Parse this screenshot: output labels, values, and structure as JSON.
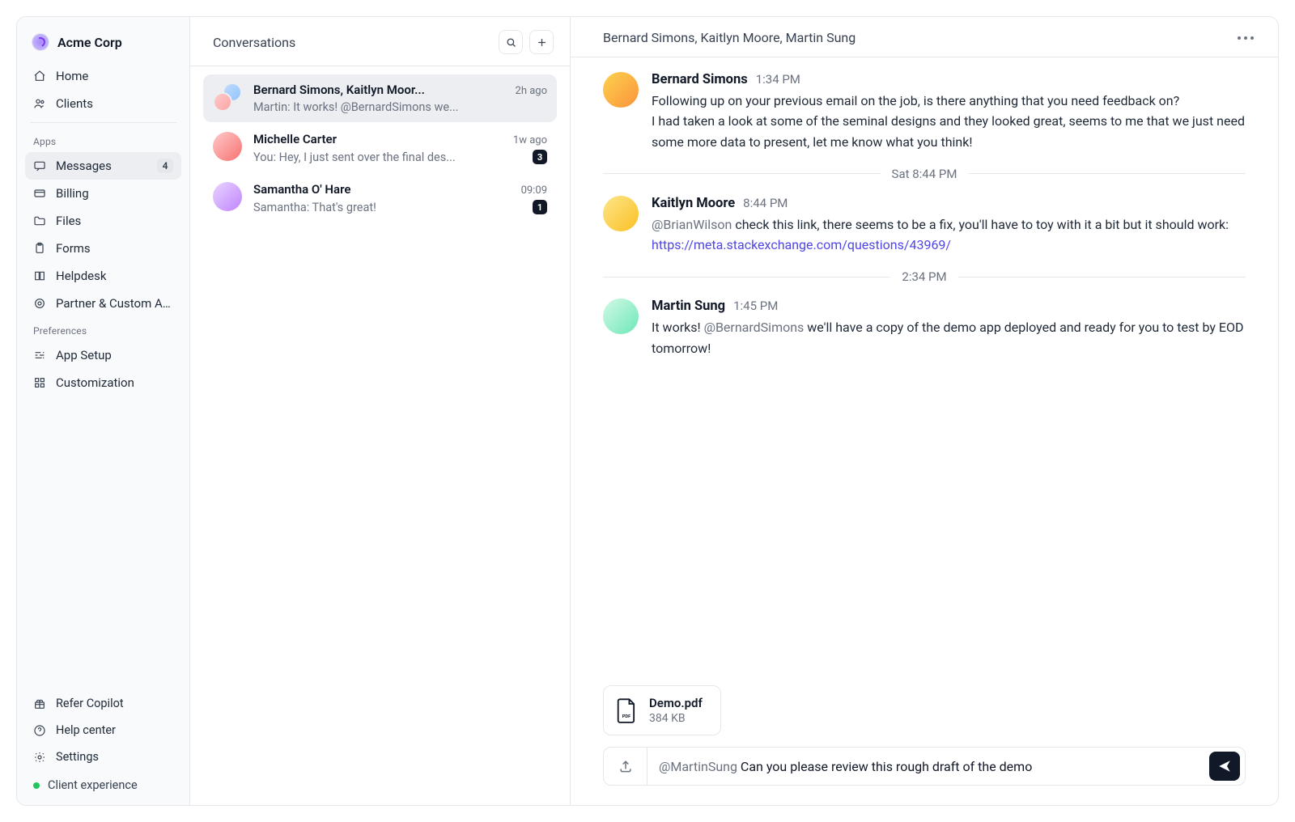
{
  "org": {
    "name": "Acme Corp"
  },
  "nav": {
    "main": [
      {
        "label": "Home"
      },
      {
        "label": "Clients"
      }
    ],
    "apps_label": "Apps",
    "apps": [
      {
        "label": "Messages",
        "badge": "4",
        "selected": true
      },
      {
        "label": "Billing"
      },
      {
        "label": "Files"
      },
      {
        "label": "Forms"
      },
      {
        "label": "Helpdesk"
      },
      {
        "label": "Partner & Custom Apps"
      }
    ],
    "prefs_label": "Preferences",
    "prefs": [
      {
        "label": "App Setup"
      },
      {
        "label": "Customization"
      }
    ],
    "footer": [
      {
        "label": "Refer Copilot"
      },
      {
        "label": "Help center"
      },
      {
        "label": "Settings"
      }
    ],
    "client_experience": "Client experience"
  },
  "conversations": {
    "title": "Conversations",
    "items": [
      {
        "name": "Bernard Simons, Kaitlyn Moor...",
        "time": "2h ago",
        "preview": "Martin: It works! @BernardSimons we...",
        "active": true
      },
      {
        "name": "Michelle Carter",
        "time": "1w ago",
        "preview": "You: Hey, I just sent over the final des...",
        "unread": "3"
      },
      {
        "name": "Samantha O' Hare",
        "time": "09:09",
        "preview": "Samantha: That's great!",
        "unread": "1"
      }
    ]
  },
  "thread": {
    "title": "Bernard Simons, Kaitlyn Moore, Martin Sung",
    "messages": [
      {
        "author": "Bernard Simons",
        "time": "1:34 PM",
        "lines": [
          "Following up on your previous email on the job, is there anything that you need feedback on?",
          "I had taken a look at some of the seminal designs and they looked great, seems to me that we just need some more data to present, let me know what you think!"
        ]
      }
    ],
    "divider1": "Sat 8:44 PM",
    "msg2": {
      "author": "Kaitlyn Moore",
      "time": "8:44 PM",
      "mention": "@BrianWilson",
      "text_mid": " check this link, there seems to be a fix, you'll have to toy with it a bit but it should work: ",
      "link": "https://meta.stackexchange.com/questions/43969/"
    },
    "divider2": "2:34 PM",
    "msg3": {
      "author": "Martin Sung",
      "time": "1:45 PM",
      "lead": "It works! ",
      "mention": "@BernardSimons",
      "tail": " we'll have a copy of the demo app deployed and ready for you to test by EOD tomorrow!"
    },
    "attachment": {
      "name": "Demo.pdf",
      "size": "384 KB"
    },
    "composer": {
      "mention": "@MartinSung",
      "text": " Can you please review this rough draft of the demo"
    }
  }
}
